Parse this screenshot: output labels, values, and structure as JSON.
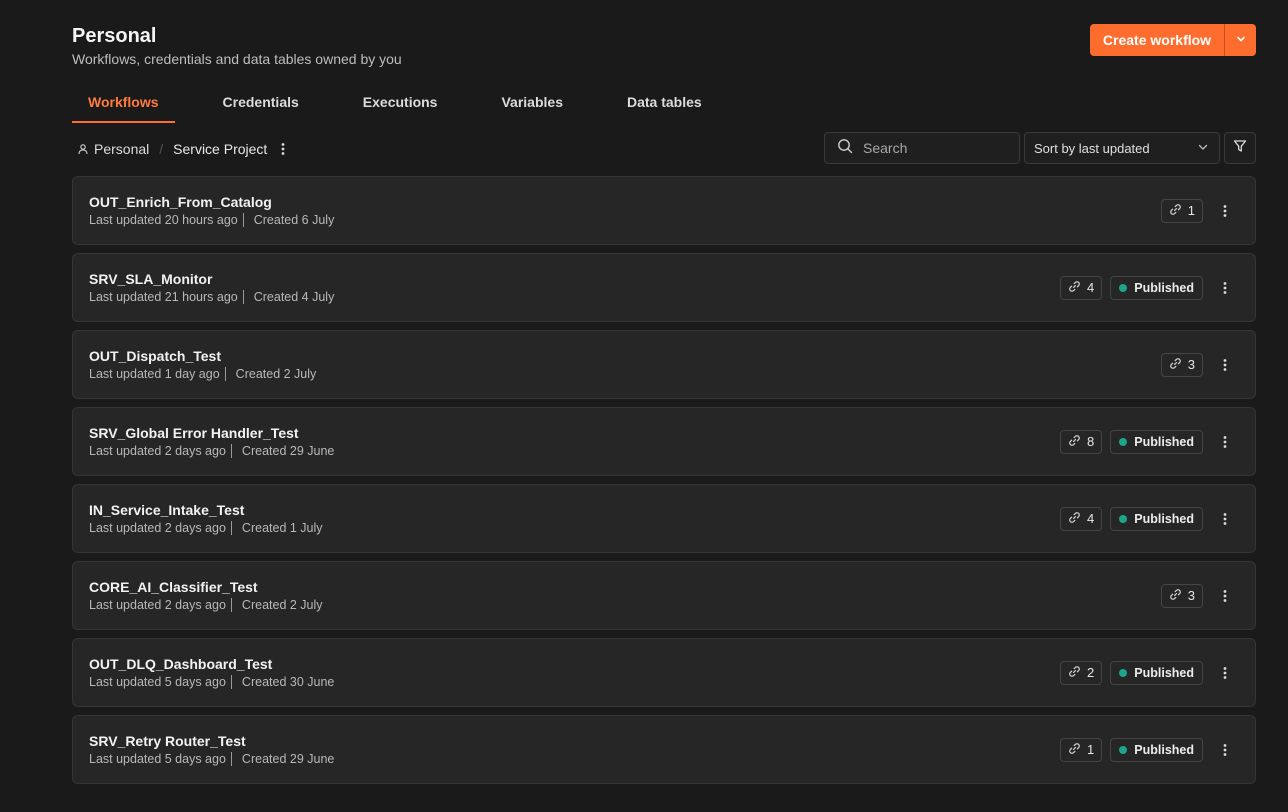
{
  "header": {
    "title": "Personal",
    "subtitle": "Workflows, credentials and data tables owned by you",
    "create_label": "Create workflow"
  },
  "tabs": [
    {
      "label": "Workflows",
      "active": true
    },
    {
      "label": "Credentials"
    },
    {
      "label": "Executions"
    },
    {
      "label": "Variables"
    },
    {
      "label": "Data tables"
    }
  ],
  "breadcrumb": {
    "root": "Personal",
    "separator": "/",
    "current": "Service Project"
  },
  "toolbar": {
    "search_placeholder": "Search",
    "sort_label": "Sort by last updated"
  },
  "colors": {
    "accent": "#ff6d2e",
    "published_dot": "#1ba58a",
    "background": "#1a1a1a",
    "card": "#262626"
  },
  "workflows": [
    {
      "name": "OUT_Enrich_From_Catalog",
      "updated": "Last updated 20 hours ago",
      "created": "Created 6 July",
      "links": "1",
      "status": ""
    },
    {
      "name": "SRV_SLA_Monitor",
      "updated": "Last updated 21 hours ago",
      "created": "Created 4 July",
      "links": "4",
      "status": "Published"
    },
    {
      "name": "OUT_Dispatch_Test",
      "updated": "Last updated 1 day ago",
      "created": "Created 2 July",
      "links": "3",
      "status": ""
    },
    {
      "name": "SRV_Global Error Handler_Test",
      "updated": "Last updated 2 days ago",
      "created": "Created 29 June",
      "links": "8",
      "status": "Published"
    },
    {
      "name": "IN_Service_Intake_Test",
      "updated": "Last updated 2 days ago",
      "created": "Created 1 July",
      "links": "4",
      "status": "Published"
    },
    {
      "name": "CORE_AI_Classifier_Test",
      "updated": "Last updated 2 days ago",
      "created": "Created 2 July",
      "links": "3",
      "status": ""
    },
    {
      "name": "OUT_DLQ_Dashboard_Test",
      "updated": "Last updated 5 days ago",
      "created": "Created 30 June",
      "links": "2",
      "status": "Published"
    },
    {
      "name": "SRV_Retry Router_Test",
      "updated": "Last updated 5 days ago",
      "created": "Created 29 June",
      "links": "1",
      "status": "Published"
    }
  ]
}
